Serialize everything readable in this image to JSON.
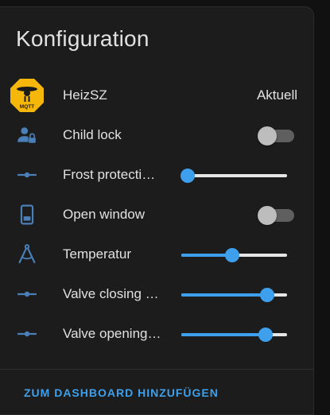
{
  "card": {
    "title": "Konfiguration"
  },
  "rows": [
    {
      "icon": "mqtt-device-icon",
      "label": "HeizSZ",
      "state": "Aktuell"
    },
    {
      "icon": "account-lock-icon",
      "label": "Child lock",
      "toggle_on": false
    },
    {
      "icon": "ray-vertex-icon",
      "label": "Frost protecti…",
      "slider_value": 0.06
    },
    {
      "icon": "cellphone-icon",
      "label": "Open window",
      "toggle_on": false
    },
    {
      "icon": "math-compass-icon",
      "label": "Temperatur",
      "slider_value": 0.48
    },
    {
      "icon": "ray-vertex-icon",
      "label": "Valve closing …",
      "slider_value": 0.81
    },
    {
      "icon": "ray-vertex-icon",
      "label": "Valve opening…",
      "slider_value": 0.8
    }
  ],
  "footer": {
    "button_label": "ZUM DASHBOARD HINZUFÜGEN"
  },
  "colors": {
    "accent": "#3ea0ec",
    "icon": "#4a7fb8",
    "card_bg": "#1c1c1c",
    "mqtt_badge": "#f5b70a"
  }
}
